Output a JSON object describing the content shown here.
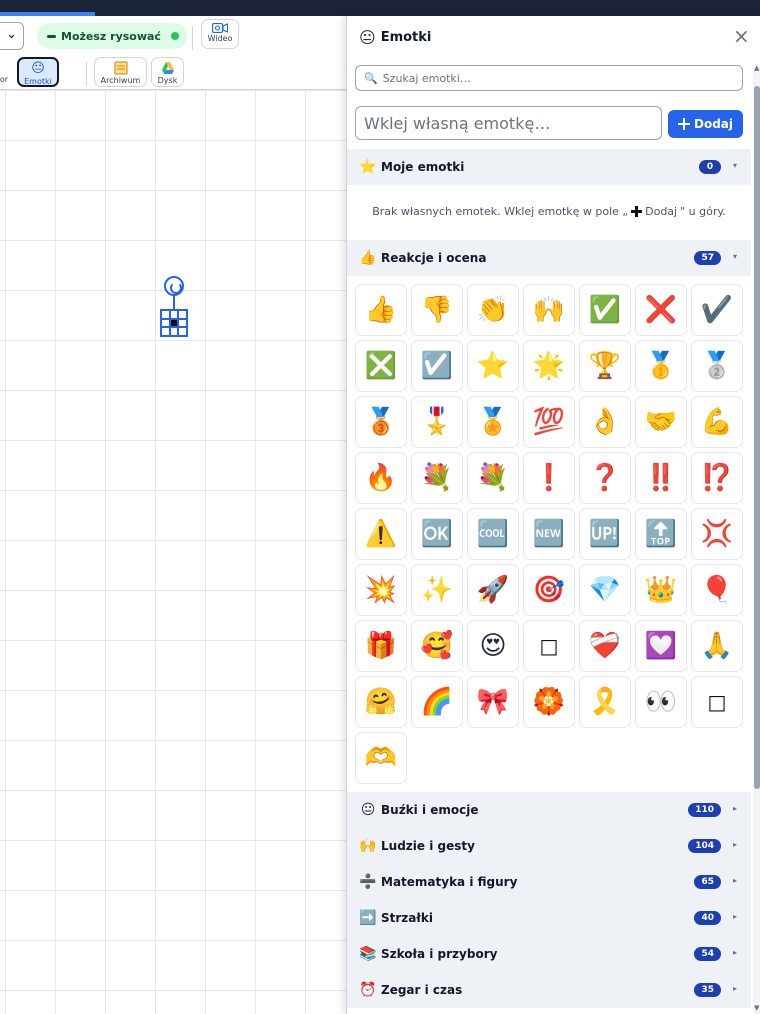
{
  "toolbar": {
    "draw_status": "Możesz rysować",
    "video_label": "Wideo",
    "tool_prev_label": "or",
    "emotki_label": "Emotki",
    "archiwum_label": "Archiwum",
    "dysk_label": "Dysk"
  },
  "panel": {
    "icon": "😐",
    "title": "Emotki",
    "close": "×",
    "search_placeholder": "Szukaj emotki…",
    "paste_placeholder": "Wklej własną emotkę…",
    "add_button": "Dodaj",
    "sections": {
      "mine": {
        "icon": "⭐",
        "name": "Moje emotki",
        "count": "0",
        "arrow": "▾"
      },
      "reactions": {
        "icon": "👍",
        "name": "Reakcje i ocena",
        "count": "57",
        "arrow": "▾"
      },
      "faces": {
        "icon": "😐",
        "name": "Buźki i emocje",
        "count": "110",
        "arrow": "▸"
      },
      "people": {
        "icon": "🙌",
        "name": "Ludzie i gesty",
        "count": "104",
        "arrow": "▸"
      },
      "math": {
        "icon": "➗",
        "name": "Matematyka i figury",
        "count": "65",
        "arrow": "▸"
      },
      "arrows": {
        "icon": "➡️",
        "name": "Strzałki",
        "count": "40",
        "arrow": "▸"
      },
      "school": {
        "icon": "📚",
        "name": "Szkoła i przybory",
        "count": "54",
        "arrow": "▸"
      },
      "clock": {
        "icon": "⏰",
        "name": "Zegar i czas",
        "count": "35",
        "arrow": "▸"
      }
    },
    "empty_text_before": "Brak własnych emotek. Wklej emotkę w pole „",
    "empty_text_add": "Dodaj",
    "empty_text_after": "\" u góry.",
    "reaction_emojis": [
      "👍",
      "👎",
      "👏",
      "🙌",
      "✅",
      "❌",
      "✔️",
      "❎",
      "☑️",
      "⭐",
      "🌟",
      "🏆",
      "🥇",
      "🥈",
      "🥉",
      "🎖️",
      "🏅",
      "💯",
      "👌",
      "🤝",
      "💪",
      "🔥",
      "💐",
      "💐",
      "❗",
      "❓",
      "‼️",
      "⁉️",
      "⚠️",
      "🆗",
      "🆒",
      "🆕",
      "🆙",
      "🔝",
      "💢",
      "💥",
      "✨",
      "🚀",
      "🎯",
      "💎",
      "👑",
      "🎈",
      "🎁",
      "🥰",
      "😍",
      "□",
      "❤️‍🩹",
      "💟",
      "🙏",
      "🤗",
      "🌈",
      "🎀",
      "🏵️",
      "🎗️",
      "👀",
      "□",
      "🫶"
    ]
  }
}
